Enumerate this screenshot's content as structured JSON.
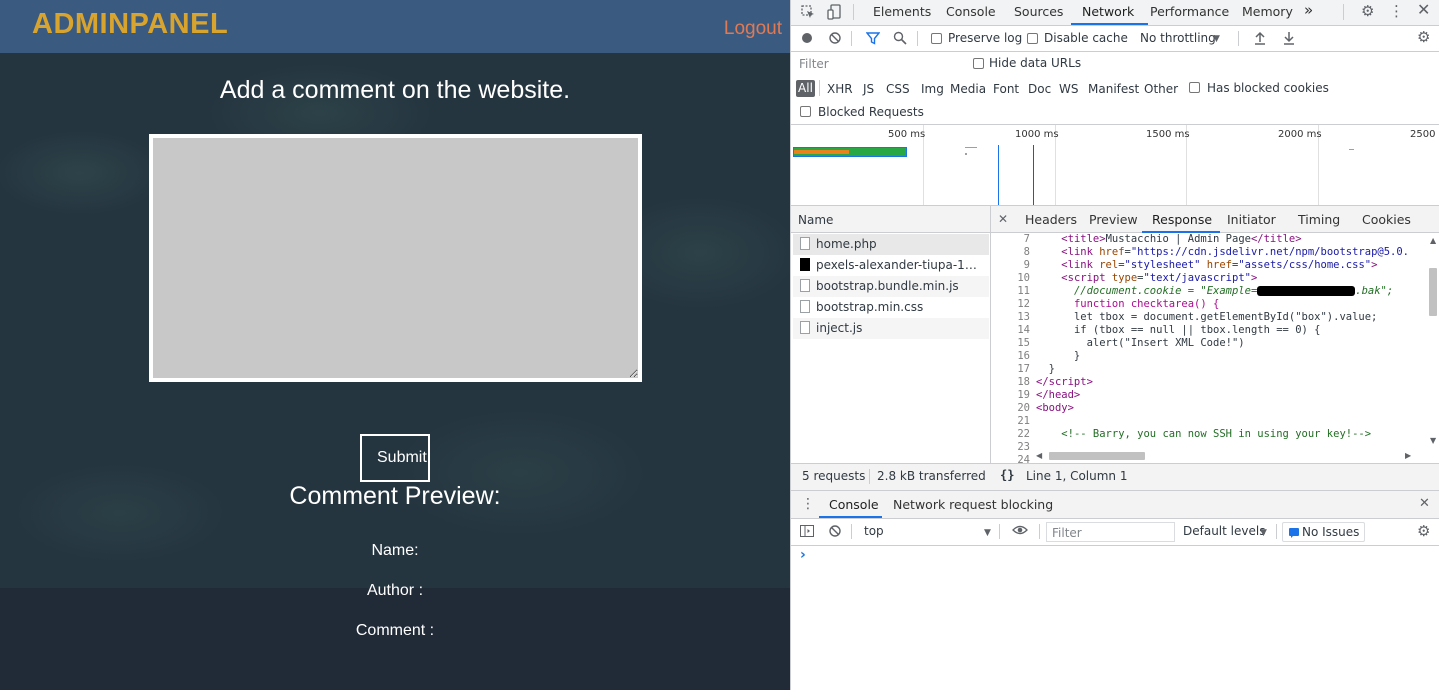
{
  "site": {
    "brand": "ADMINPANEL",
    "logout": "Logout",
    "heading": "Add a comment on the website.",
    "textarea_value": "",
    "submit_label": "Submit",
    "preview_title": "Comment Preview:",
    "fields": [
      "Name:",
      "Author :",
      "Comment :"
    ]
  },
  "devtools": {
    "tabs": [
      "Elements",
      "Console",
      "Sources",
      "Network",
      "Performance",
      "Memory"
    ],
    "active_tab": "Network",
    "more_tabs": "»",
    "toolbar": {
      "preserve_log": "Preserve log",
      "disable_cache": "Disable cache",
      "throttling": "No throttling"
    },
    "filter": {
      "placeholder": "Filter",
      "hide_data_urls": "Hide data URLs",
      "types": [
        "All",
        "XHR",
        "JS",
        "CSS",
        "Img",
        "Media",
        "Font",
        "Doc",
        "WS",
        "Manifest",
        "Other"
      ],
      "has_blocked_cookies": "Has blocked cookies",
      "blocked_requests": "Blocked Requests"
    },
    "timeline_labels": [
      "500 ms",
      "1000 ms",
      "1500 ms",
      "2000 ms",
      "2500 ms"
    ],
    "name_header": "Name",
    "requests": [
      "home.php",
      "pexels-alexander-tiupa-1921…",
      "bootstrap.bundle.min.js",
      "bootstrap.min.css",
      "inject.js"
    ],
    "detail_tabs": [
      "Headers",
      "Preview",
      "Response",
      "Initiator",
      "Timing",
      "Cookies"
    ],
    "active_detail_tab": "Response",
    "code_line_numbers": [
      "7",
      "8",
      "9",
      "10",
      "11",
      "12",
      "13",
      "14",
      "15",
      "16",
      "17",
      "18",
      "19",
      "20",
      "21",
      "22",
      "23",
      "24"
    ],
    "code": {
      "l7_title": "Mustacchio | Admin Page",
      "l8_href": "\"https://cdn.jsdelivr.net/npm/bootstrap@5.0.",
      "l9_href": "\"assets/css/home.css\"",
      "l10_type": "\"text/javascript\"",
      "l11_comment_a": "//document.cookie = \"Example=",
      "l11_comment_b": ".bak\";",
      "l12": "function checktarea() {",
      "l13": "let tbox = document.getElementById(\"box\").value;",
      "l14": "if (tbox == null || tbox.length == 0) {",
      "l15": "alert(\"Insert XML Code!\")",
      "l22_comment": "<!-- Barry, you can now SSH in using your key!-->"
    },
    "status": {
      "requests": "5 requests",
      "transferred": "2.8 kB transferred",
      "position": "Line 1, Column 1",
      "pretty_print": "{}"
    },
    "drawer": {
      "tabs": [
        "Console",
        "Network request blocking"
      ],
      "context": "top",
      "filter_placeholder": "Filter",
      "levels": "Default levels",
      "issues": "No Issues",
      "prompt": "›"
    }
  }
}
